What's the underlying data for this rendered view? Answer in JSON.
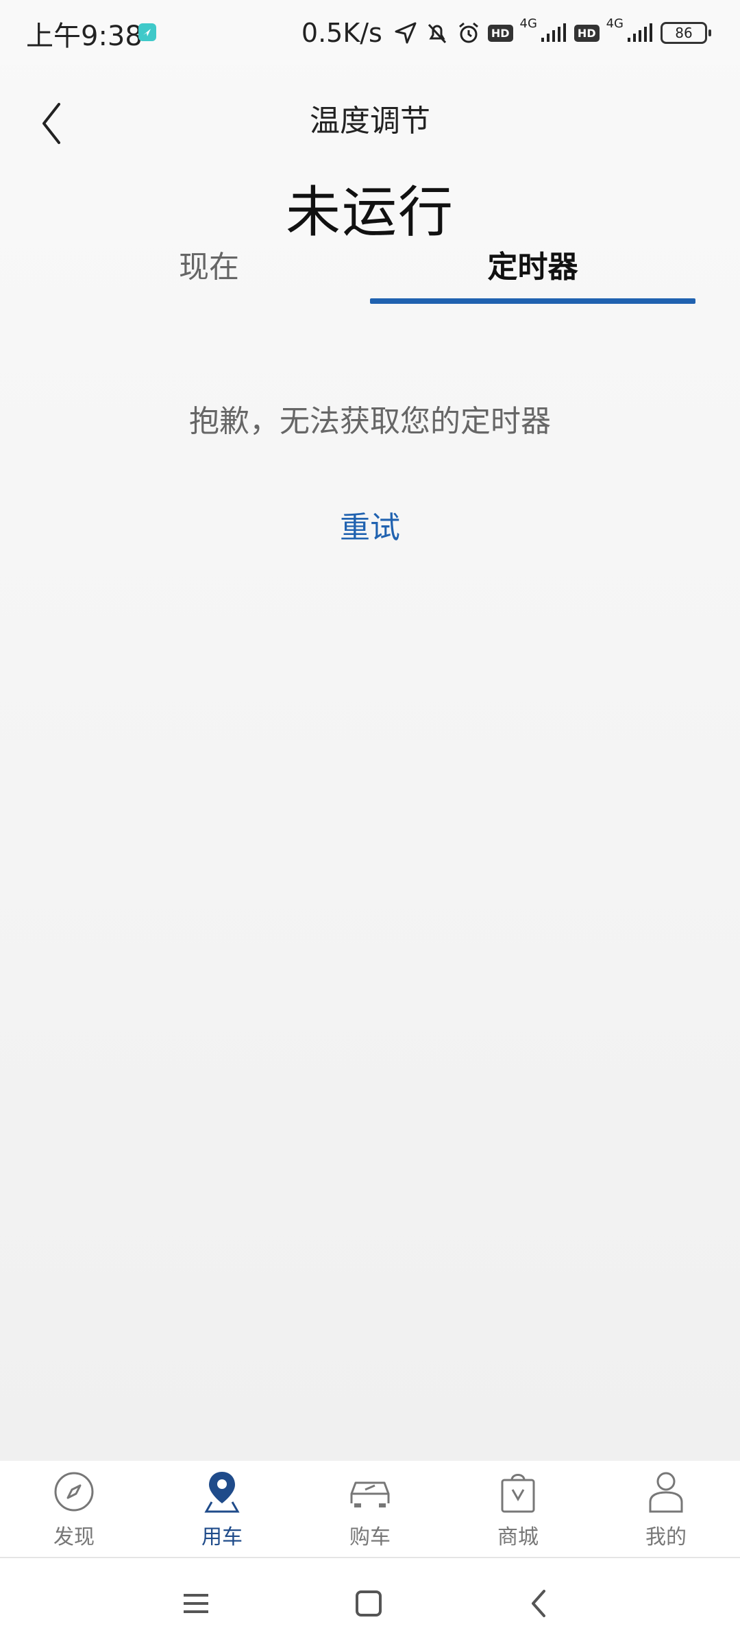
{
  "status_bar": {
    "time": "上午9:38",
    "net_speed": "0.5K/s",
    "network_a": "4G",
    "network_b": "4G",
    "hd_a": "HD",
    "hd_b": "HD",
    "battery": "86"
  },
  "header": {
    "title": "温度调节"
  },
  "status": {
    "text": "未运行"
  },
  "tabs": {
    "now": "现在",
    "timer": "定时器",
    "active": "timer"
  },
  "content": {
    "error_message": "抱歉，无法获取您的定时器",
    "retry": "重试"
  },
  "bottom_nav": {
    "items": [
      {
        "label": "发现",
        "icon": "compass-icon"
      },
      {
        "label": "用车",
        "icon": "location-pin-icon"
      },
      {
        "label": "购车",
        "icon": "car-icon"
      },
      {
        "label": "商城",
        "icon": "shopping-bag-icon"
      },
      {
        "label": "我的",
        "icon": "person-icon"
      }
    ],
    "active_index": 1
  },
  "colors": {
    "accent": "#2062b0",
    "nav_active": "#1f4b8a",
    "muted_text": "#666666"
  }
}
